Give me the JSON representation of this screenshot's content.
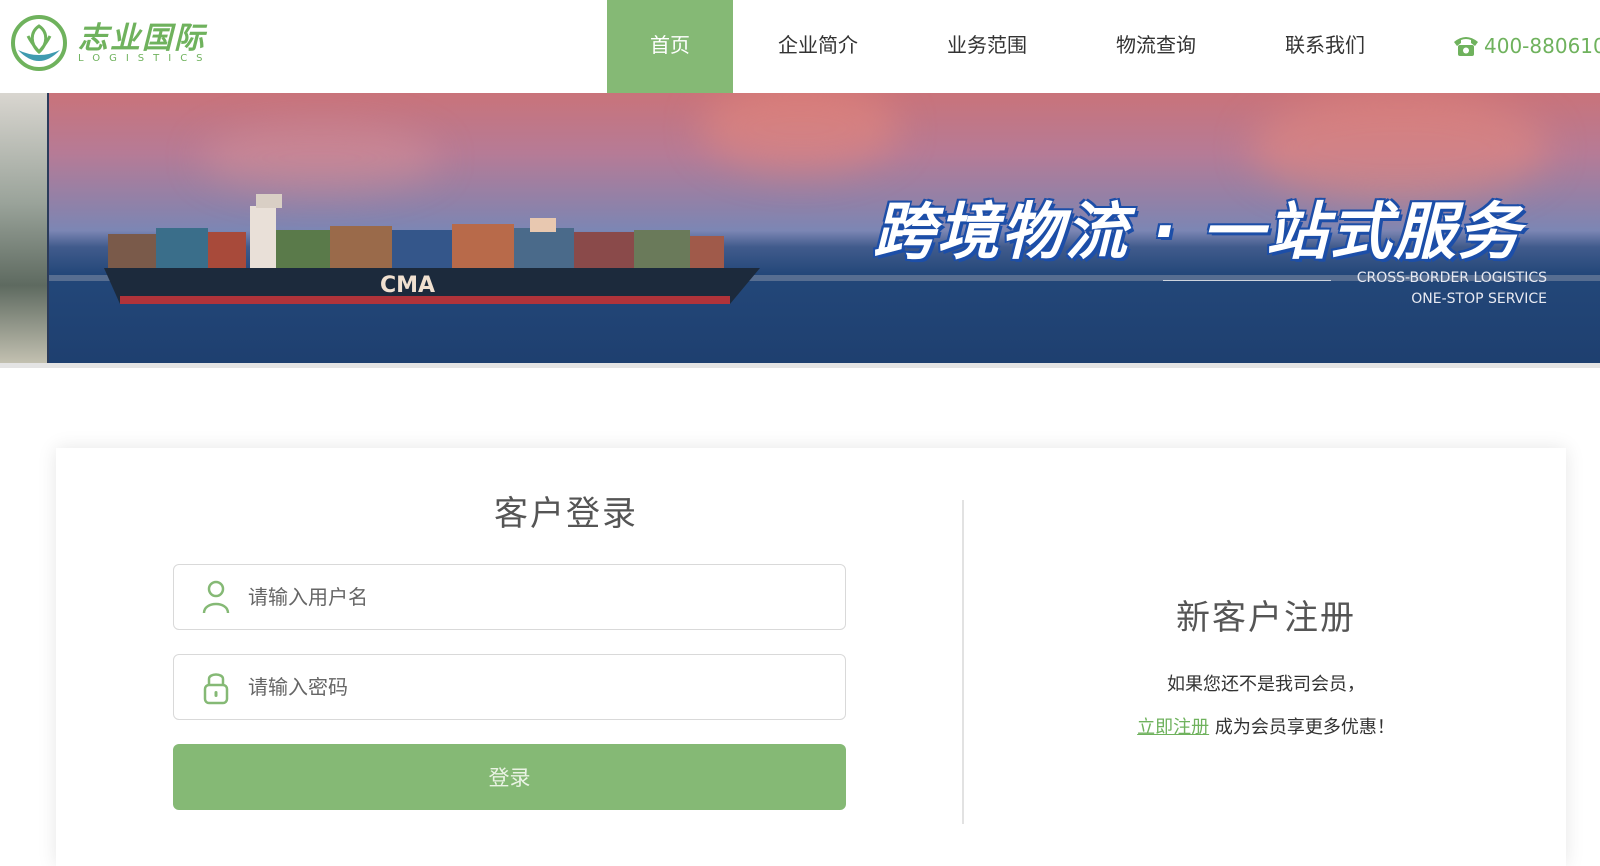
{
  "brand": {
    "name_cn": "志业国际",
    "name_en": "LOGISTICS",
    "accent_color": "#85b975",
    "text_green": "#6fb25d"
  },
  "nav": {
    "items": [
      {
        "label": "首页",
        "active": true
      },
      {
        "label": "企业简介",
        "active": false
      },
      {
        "label": "业务范围",
        "active": false
      },
      {
        "label": "物流查询",
        "active": false
      },
      {
        "label": "联系我们",
        "active": false
      }
    ],
    "phone": "400-880610",
    "phone_icon": "phone-icon"
  },
  "banner": {
    "title": "跨境物流 · 一站式服务",
    "subtitle_line1": "CROSS-BORDER LOGISTICS",
    "subtitle_line2": "ONE-STOP SERVICE",
    "ship_label": "CMA"
  },
  "login": {
    "title": "客户登录",
    "username_placeholder": "请输入用户名",
    "password_placeholder": "请输入密码",
    "submit_label": "登录",
    "user_icon": "user-icon",
    "lock_icon": "lock-icon"
  },
  "register": {
    "title": "新客户注册",
    "text_line1": "如果您还不是我司会员，",
    "link_label": "立即注册",
    "text_line2_suffix": " 成为会员享更多优惠！"
  }
}
